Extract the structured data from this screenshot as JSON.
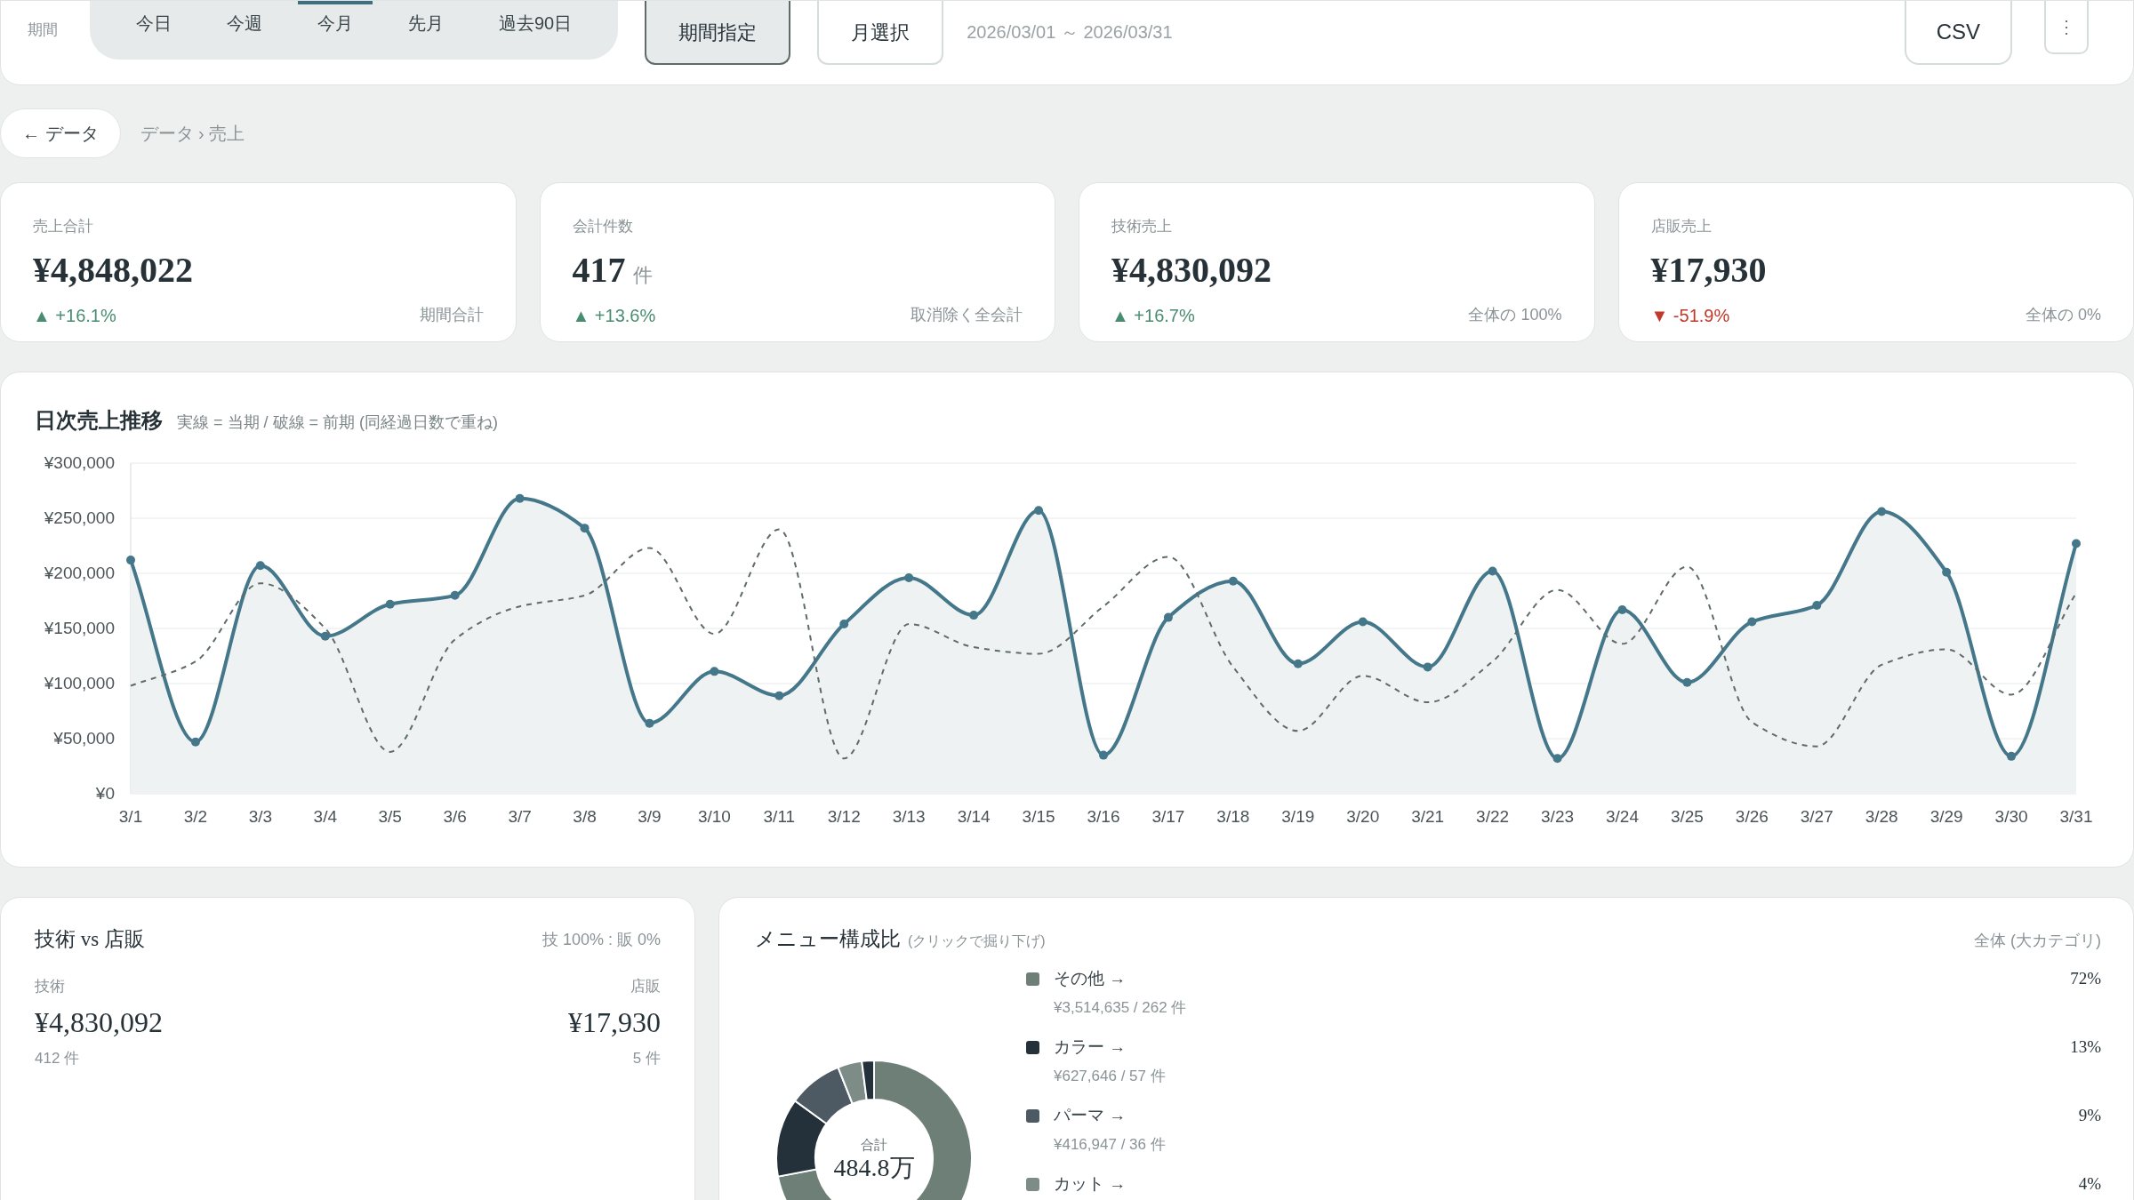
{
  "filter": {
    "label": "期間",
    "tabs": [
      {
        "label": "今日",
        "selected": false
      },
      {
        "label": "今週",
        "selected": false
      },
      {
        "label": "今月",
        "selected": true
      },
      {
        "label": "先月",
        "selected": false
      },
      {
        "label": "過去90日",
        "selected": false
      }
    ],
    "buttons": [
      {
        "label": "期間指定",
        "selected": true
      },
      {
        "label": "月選択",
        "selected": false
      }
    ],
    "range": "2026/03/01 ～ 2026/03/31",
    "export": "CSV",
    "more": "⋮"
  },
  "breadcrumb": {
    "back": "← データ",
    "path": "データ › 売上"
  },
  "kpis": [
    {
      "label": "売上合計",
      "value": "¥4,848,022",
      "change": "▲ +16.1%",
      "color": "#4a8c72",
      "note": "期間合計"
    },
    {
      "label": "会計件数",
      "value": "417",
      "unit": "件",
      "change": "▲ +13.6%",
      "color": "#4a8c72",
      "note": "取消除く全会計"
    },
    {
      "label": "技術売上",
      "value": "¥4,830,092",
      "change": "▲ +16.7%",
      "color": "#4a8c72",
      "note": "全体の 100%"
    },
    {
      "label": "店販売上",
      "value": "¥17,930",
      "change": "▼ -51.9%",
      "color": "#c0392b",
      "note": "全体の 0%"
    }
  ],
  "daily": {
    "title": "日次売上推移",
    "subtitle": "実線 = 当期 / 破線 = 前期 (同経過日数で重ね)",
    "chart_data": {
      "type": "line",
      "grid": true,
      "categories": [
        "3/1",
        "3/2",
        "3/3",
        "3/4",
        "3/5",
        "3/6",
        "3/7",
        "3/8",
        "3/9",
        "3/10",
        "3/11",
        "3/12",
        "3/13",
        "3/14",
        "3/15",
        "3/16",
        "3/17",
        "3/18",
        "3/19",
        "3/20",
        "3/21",
        "3/22",
        "3/23",
        "3/24",
        "3/25",
        "3/26",
        "3/27",
        "3/28",
        "3/29",
        "3/30",
        "3/31"
      ],
      "series": [
        {
          "type": "area",
          "color": "#44778a",
          "line_style": "solid",
          "marker": "circle",
          "values": [
            212000,
            47000,
            207000,
            143000,
            172000,
            180000,
            268000,
            241000,
            64000,
            111000,
            89000,
            154000,
            196000,
            162000,
            257000,
            35000,
            160000,
            193000,
            118000,
            156000,
            115000,
            202000,
            32000,
            167000,
            101000,
            156000,
            171000,
            256000,
            201000,
            34000,
            227000
          ]
        },
        {
          "type": "line",
          "color": "#5f6b6b",
          "line_style": "dashed",
          "values": [
            98000,
            120000,
            191000,
            150000,
            38000,
            140000,
            170000,
            180000,
            223000,
            145000,
            240000,
            32000,
            154000,
            133000,
            127000,
            170000,
            215000,
            115000,
            57000,
            107000,
            83000,
            120000,
            185000,
            136000,
            206000,
            65000,
            43000,
            117000,
            131000,
            90000,
            182000
          ]
        }
      ],
      "ylim": [
        0,
        300000
      ],
      "yticks": [
        {
          "value": 0,
          "label": "¥0"
        },
        {
          "value": 50000,
          "label": "¥50,000"
        },
        {
          "value": 100000,
          "label": "¥100,000"
        },
        {
          "value": 150000,
          "label": "¥150,000"
        },
        {
          "value": 200000,
          "label": "¥200,000"
        },
        {
          "value": 250000,
          "label": "¥250,000"
        },
        {
          "value": 300000,
          "label": "¥300,000"
        }
      ]
    }
  },
  "split": {
    "title": "技術 vs 店販",
    "ratio": "技 100% : 販 0%",
    "left": {
      "label": "技術",
      "value": "¥4,830,092",
      "count": "412 件"
    },
    "right": {
      "label": "店販",
      "value": "¥17,930",
      "count": "5 件"
    }
  },
  "menu": {
    "title": "メニュー構成比",
    "hint": "(クリックで掘り下げ)",
    "scope": "全体 (大カテゴリ)",
    "center_label": "合計",
    "center_value": "484.8万",
    "items": [
      {
        "arrow": "→",
        "detail": "¥3,514,635 / 262 件",
        "percent": "72%",
        "color": "#6e7f78"
      },
      {
        "arrow": "→",
        "detail": "¥627,646 / 57 件",
        "percent": "13%",
        "color": "#25313a"
      },
      {
        "arrow": "→",
        "detail": "¥416,947 / 36 件",
        "percent": "9%",
        "color": "#4d5a63"
      },
      {
        "arrow": "→",
        "percent": "4%",
        "color": "#7d8c86"
      }
    ],
    "chart_data": {
      "type": "donut",
      "categories": [
        "その他",
        "カラー",
        "パーマ",
        "カット",
        null
      ],
      "values": [
        72,
        13,
        9,
        4,
        2
      ]
    }
  }
}
